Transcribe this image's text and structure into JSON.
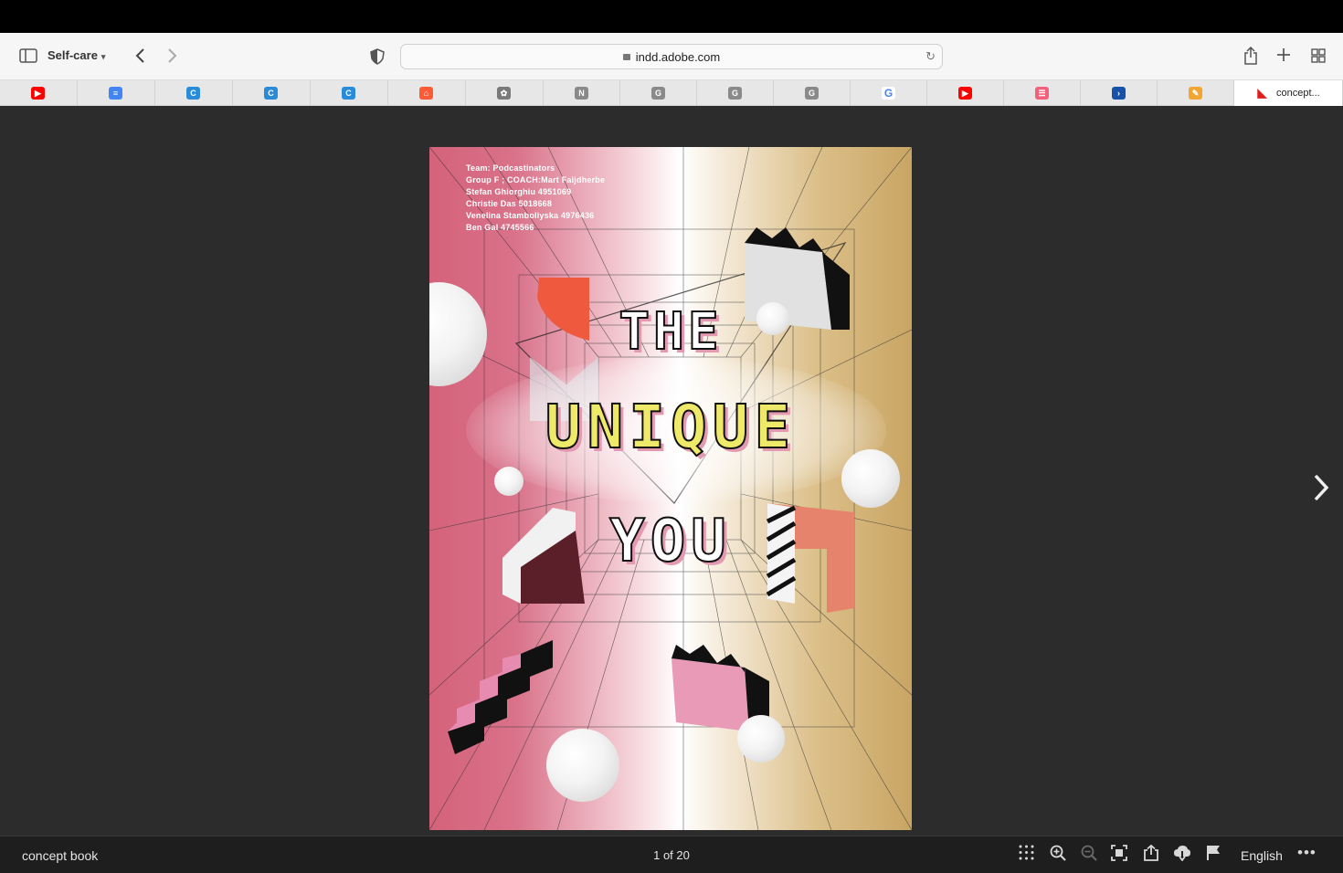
{
  "browser": {
    "profile_label": "Self-care",
    "address": "indd.adobe.com",
    "tabs": [
      {
        "icon": "youtube-icon",
        "color": "#ff0000",
        "glyph": "▶"
      },
      {
        "icon": "google-docs-icon",
        "color": "#4285f4",
        "glyph": "≡"
      },
      {
        "icon": "canva-icon",
        "color": "#2a8bd8",
        "glyph": "C"
      },
      {
        "icon": "canva-icon",
        "color": "#2a8bd8",
        "glyph": "C"
      },
      {
        "icon": "canva-icon",
        "color": "#2a8bd8",
        "glyph": "C"
      },
      {
        "icon": "graduation-cap-icon",
        "color": "#ff5a36",
        "glyph": "⌂"
      },
      {
        "icon": "tree-icon",
        "color": "#7a7a7a",
        "glyph": "✿"
      },
      {
        "icon": "letter-n-icon",
        "color": "#8a8a8a",
        "glyph": "N"
      },
      {
        "icon": "letter-g-icon",
        "color": "#8a8a8a",
        "glyph": "G"
      },
      {
        "icon": "letter-g-icon",
        "color": "#8a8a8a",
        "glyph": "G"
      },
      {
        "icon": "letter-g-icon",
        "color": "#8a8a8a",
        "glyph": "G"
      },
      {
        "icon": "google-icon",
        "color": "#ffffff",
        "glyph": "G"
      },
      {
        "icon": "youtube-icon",
        "color": "#ff0000",
        "glyph": "▶"
      },
      {
        "icon": "chat-icon",
        "color": "#f2607a",
        "glyph": "☰"
      },
      {
        "icon": "arrow-app-icon",
        "color": "#1653a8",
        "glyph": "›"
      },
      {
        "icon": "notes-icon",
        "color": "#f2a531",
        "glyph": "✎"
      }
    ],
    "active_tab": {
      "icon": "adobe-icon",
      "title": "concept..."
    }
  },
  "document": {
    "team_lines": [
      "Team: Podcastinators",
      "Group F ;  COACH:Mart Faijdherbe",
      "Stefan Ghiorghiu 4951069",
      "Christie Das 5018668",
      "Venelina Stamboliyska 4976436",
      "Ben Gal 4745566"
    ],
    "headline_1": "THE",
    "headline_2": "UNIQUE",
    "headline_3": "YOU"
  },
  "viewer": {
    "doc_name": "concept book",
    "page_indicator": "1 of 20",
    "language": "English"
  },
  "colors": {
    "page_left": "#d4627a",
    "page_right": "#c9a564",
    "unique_fill": "#efe96a",
    "shadow_pink": "#e39ab0"
  }
}
